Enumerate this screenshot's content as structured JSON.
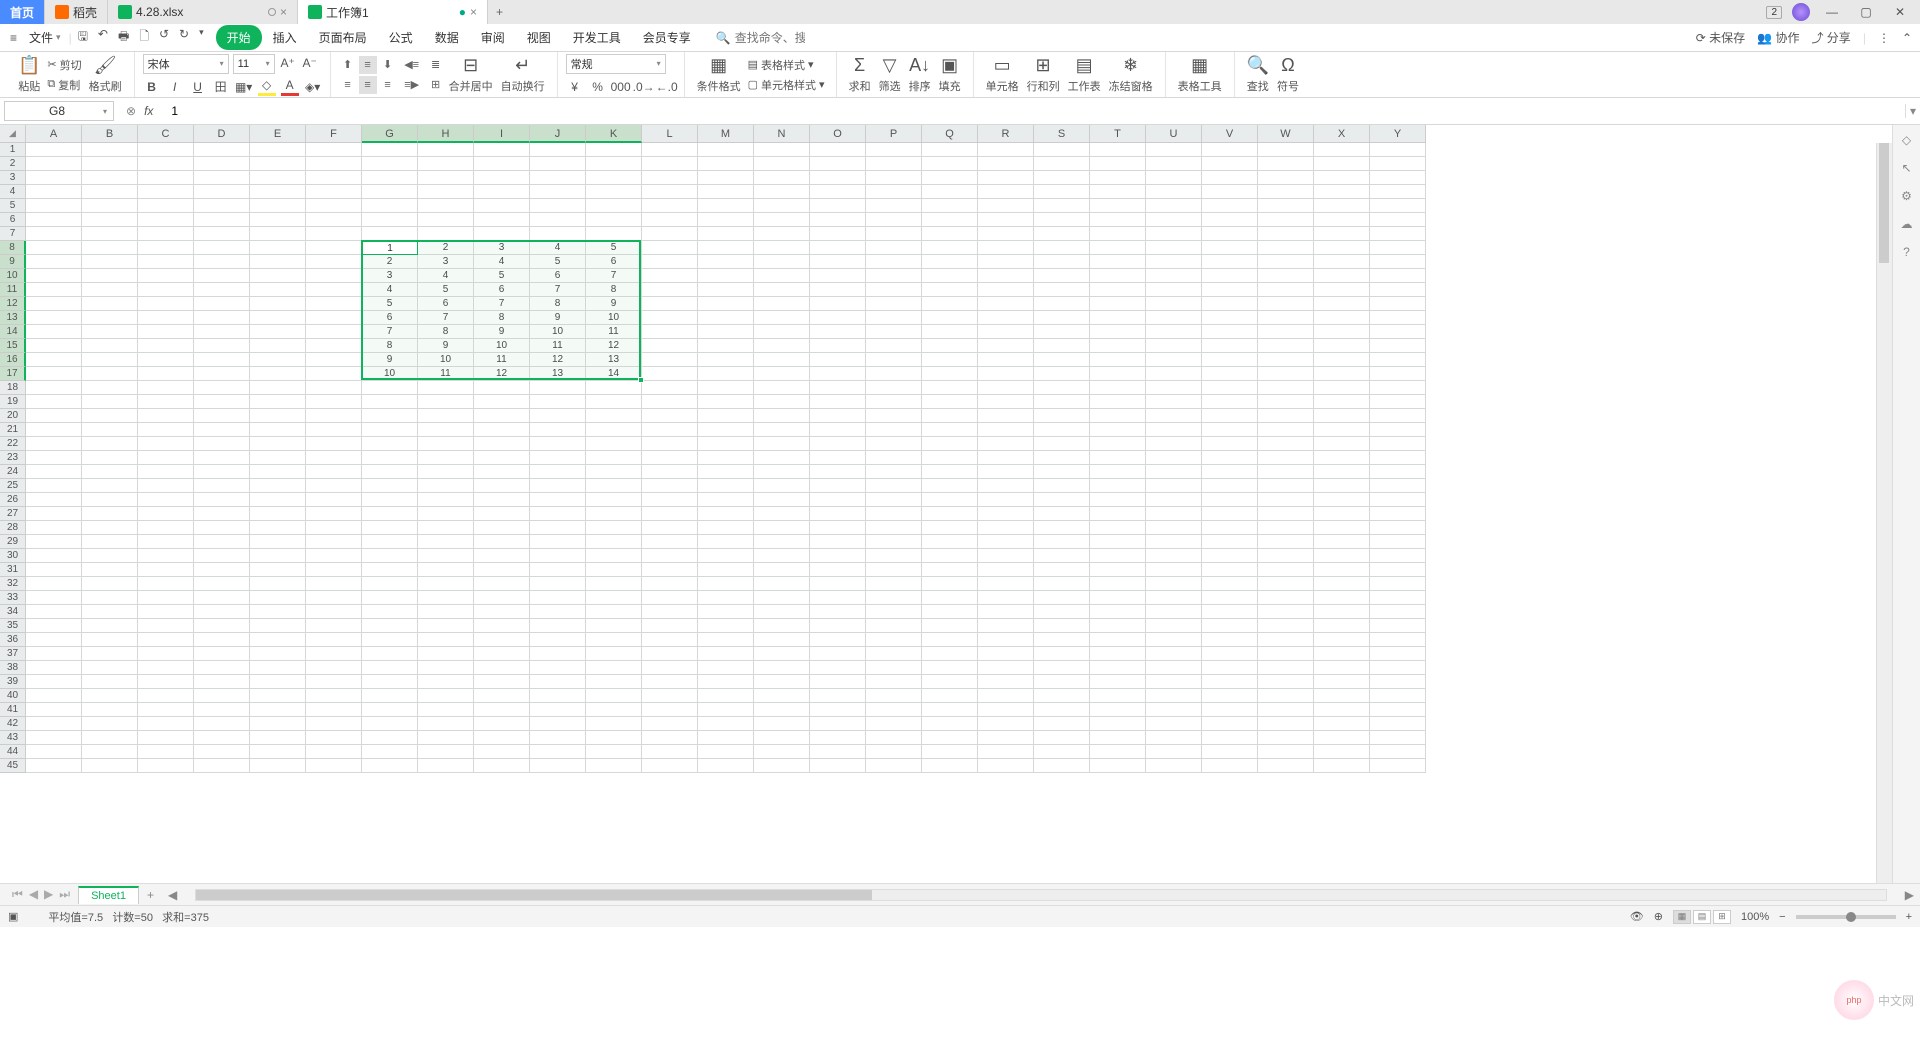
{
  "titlebar": {
    "home": "首页",
    "tabs": [
      {
        "icon": "orange",
        "label": "稻壳",
        "close": true
      },
      {
        "icon": "green",
        "label": "4.28.xlsx",
        "close": true,
        "circ": true
      },
      {
        "icon": "green",
        "label": "工作簿1",
        "mod": "●",
        "active": true
      }
    ],
    "add": "+",
    "right_badge": "2"
  },
  "menubar": {
    "file": "文件",
    "menus": [
      "开始",
      "插入",
      "页面布局",
      "公式",
      "数据",
      "审阅",
      "视图",
      "开发工具",
      "会员专享"
    ],
    "active_menu": 0,
    "search_placeholder": "查找命令、搜索模板",
    "unsaved": "未保存",
    "collab": "协作",
    "share": "分享"
  },
  "ribbon": {
    "paste": "粘贴",
    "cut": "剪切",
    "copy": "复制",
    "fmt_paint": "格式刷",
    "font_name": "宋体",
    "font_size": "11",
    "merge": "合并居中",
    "wrap": "自动换行",
    "num_fmt": "常规",
    "cond_fmt": "条件格式",
    "tbl_style": "表格样式",
    "cell_style": "单元格样式",
    "sum": "求和",
    "filter": "筛选",
    "sort": "排序",
    "fill": "填充",
    "cell": "单元格",
    "rowcol": "行和列",
    "sheet": "工作表",
    "freeze": "冻结窗格",
    "tbl_tools": "表格工具",
    "find": "查找",
    "symbol": "符号"
  },
  "fbar": {
    "name": "G8",
    "formula": "1"
  },
  "grid": {
    "cols": [
      "A",
      "B",
      "C",
      "D",
      "E",
      "F",
      "G",
      "H",
      "I",
      "J",
      "K",
      "L",
      "M",
      "N",
      "O",
      "P",
      "Q",
      "R",
      "S",
      "T",
      "U",
      "V",
      "W",
      "X",
      "Y"
    ],
    "rows": 45,
    "sel_cols": [
      6,
      7,
      8,
      9,
      10
    ],
    "sel_rows": [
      8,
      9,
      10,
      11,
      12,
      13,
      14,
      15,
      16,
      17
    ],
    "data_start_col": 6,
    "data_start_row": 8,
    "data": [
      [
        1,
        2,
        3,
        4,
        5
      ],
      [
        2,
        3,
        4,
        5,
        6
      ],
      [
        3,
        4,
        5,
        6,
        7
      ],
      [
        4,
        5,
        6,
        7,
        8
      ],
      [
        5,
        6,
        7,
        8,
        9
      ],
      [
        6,
        7,
        8,
        9,
        10
      ],
      [
        7,
        8,
        9,
        10,
        11
      ],
      [
        8,
        9,
        10,
        11,
        12
      ],
      [
        9,
        10,
        11,
        12,
        13
      ],
      [
        10,
        11,
        12,
        13,
        14
      ]
    ]
  },
  "sheets": {
    "active": "Sheet1"
  },
  "statusbar": {
    "avg_label": "平均值=",
    "avg": "7.5",
    "cnt_label": "计数=",
    "cnt": "50",
    "sum_label": "求和=",
    "sum": "375",
    "zoom": "100%"
  },
  "watermark": {
    "logo": "php",
    "text": "中文网"
  }
}
